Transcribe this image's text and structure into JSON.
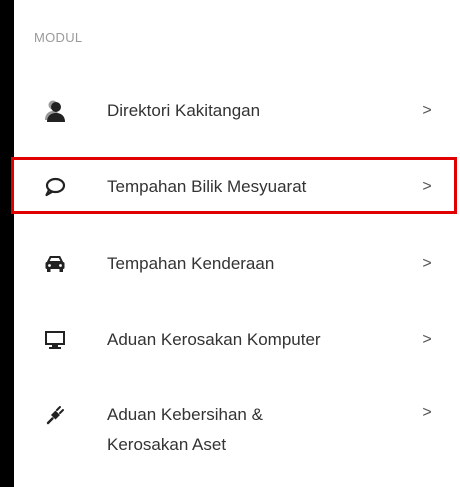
{
  "section": {
    "title": "MODUL"
  },
  "menu": {
    "items": [
      {
        "label": "Direktori Kakitangan",
        "icon": "user-icon",
        "chevron": ">"
      },
      {
        "label": "Tempahan Bilik Mesyuarat",
        "icon": "chat-bubble-icon",
        "chevron": ">",
        "highlighted": true
      },
      {
        "label": "Tempahan Kenderaan",
        "icon": "car-icon",
        "chevron": ">"
      },
      {
        "label": "Aduan Kerosakan Komputer",
        "icon": "monitor-icon",
        "chevron": ">"
      },
      {
        "label_line1": "Aduan Kebersihan &",
        "label_line2": "Kerosakan Aset",
        "icon": "plug-icon",
        "chevron": ">"
      }
    ]
  },
  "colors": {
    "highlight": "#e00000",
    "text": "#333333",
    "muted": "#9a9a9a"
  }
}
